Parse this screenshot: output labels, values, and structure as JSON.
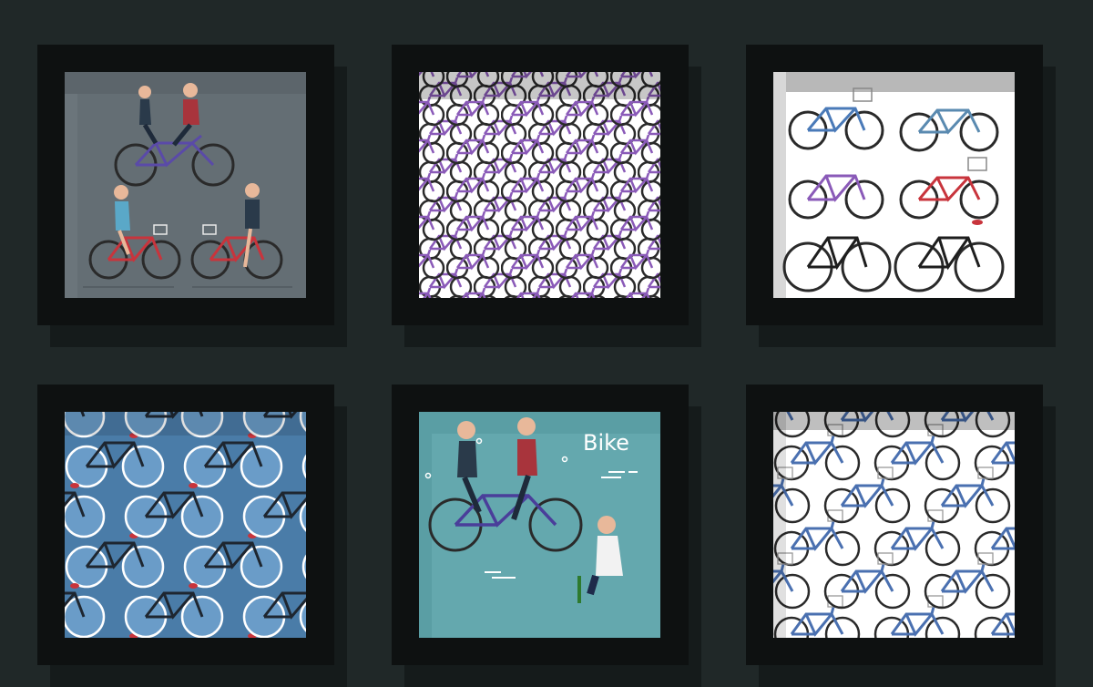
{
  "scene": {
    "background": "#202828",
    "frame_color": "#0e1111",
    "tiles": [
      {
        "name": "tandem-and-riders",
        "bg": "#6b757b",
        "bike_colors": [
          "#5a4aa8",
          "#c8343c"
        ]
      },
      {
        "name": "purple-bike-pattern",
        "bg": "#ffffff",
        "bike_colors": [
          "#8a5ab8",
          "#2a2a2a"
        ]
      },
      {
        "name": "six-bikes-grid",
        "bg": "#ffffff",
        "bike_colors": [
          "#4a7ab8",
          "#5a8ab0",
          "#8a5ab8",
          "#c8343c",
          "#1e1e1e",
          "#1e1e1e"
        ]
      },
      {
        "name": "blue-pattern",
        "bg": "#4a7ca8",
        "bike_colors": [
          "#1e2630",
          "#c8343c"
        ]
      },
      {
        "name": "bike-poster",
        "bg": "#5a9ea4",
        "bike_colors": [
          "#4a3e9a"
        ]
      },
      {
        "name": "blue-basket-pattern",
        "bg": "#ffffff",
        "bike_colors": [
          "#4a70b0"
        ]
      }
    ]
  },
  "poster": {
    "title": "Bike"
  }
}
